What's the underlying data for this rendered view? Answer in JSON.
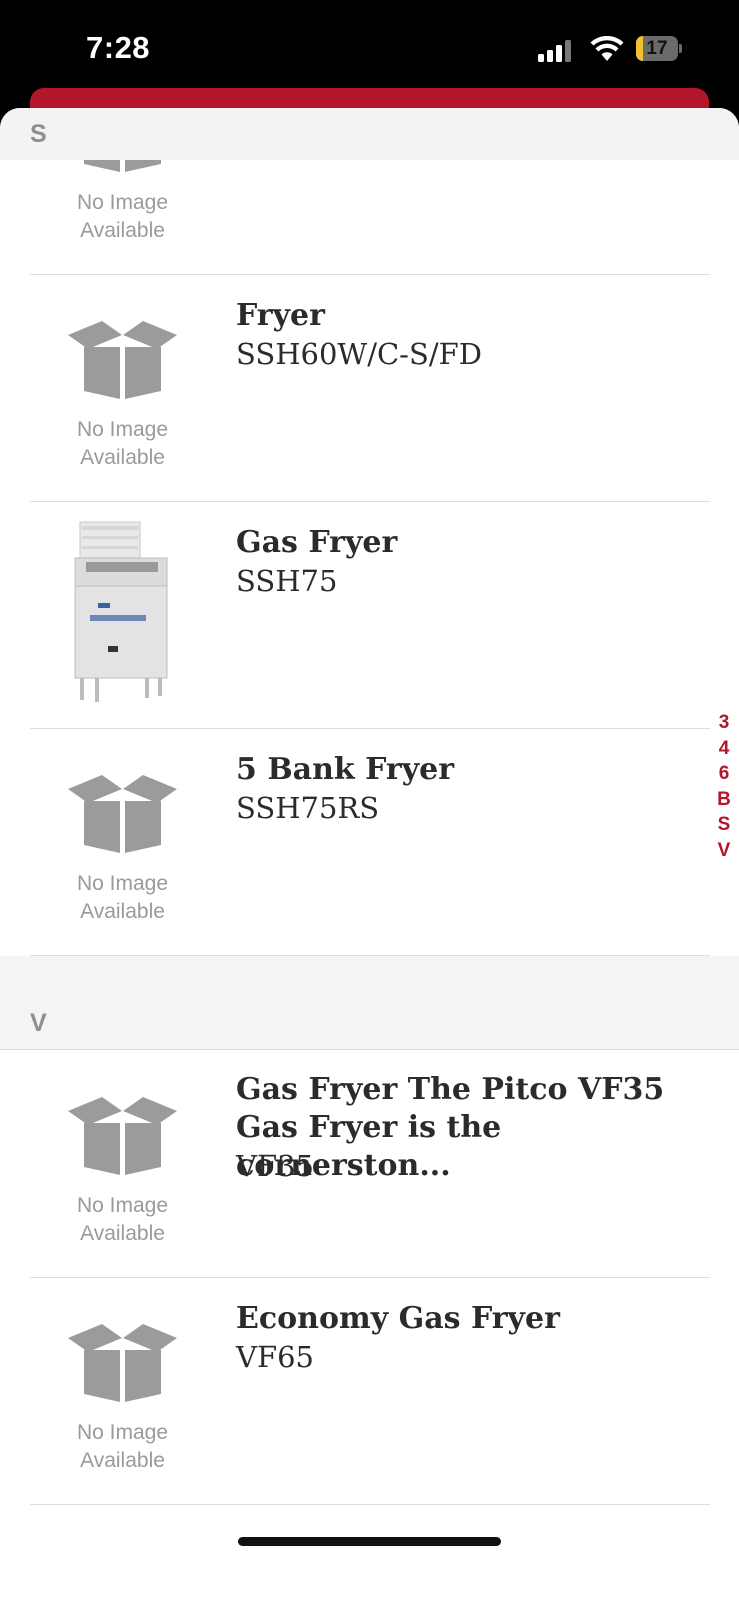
{
  "status_bar": {
    "time": "7:28",
    "battery": "17",
    "battery_level": 0.17
  },
  "list": {
    "sticky_header": "S",
    "partial_item": {
      "no_image_text": [
        "No Image",
        "Available"
      ]
    },
    "sections": [
      {
        "letter": "S",
        "items": [
          {
            "name": "Fryer",
            "model": "SSH60W/C-S/FD",
            "image": "none"
          },
          {
            "name": "Gas Fryer",
            "model": "SSH75",
            "image": "fryer-photo"
          },
          {
            "name": "5 Bank Fryer",
            "model": "SSH75RS",
            "image": "none"
          }
        ]
      },
      {
        "letter": "V",
        "items": [
          {
            "name": "Gas Fryer The Pitco VF35",
            "name_line2": "Gas Fryer is the cornerston...",
            "model": "VF35",
            "image": "none"
          },
          {
            "name": "Economy Gas Fryer",
            "model": "VF65",
            "image": "none"
          }
        ]
      }
    ],
    "no_image_line1": "No Image",
    "no_image_line2": "Available"
  },
  "index": [
    "3",
    "4",
    "6",
    "B",
    "S",
    "V"
  ],
  "colors": {
    "accent": "#b3152b",
    "placeholder_gray": "#9a9a9a",
    "box_gray": "#9b9b9b"
  }
}
